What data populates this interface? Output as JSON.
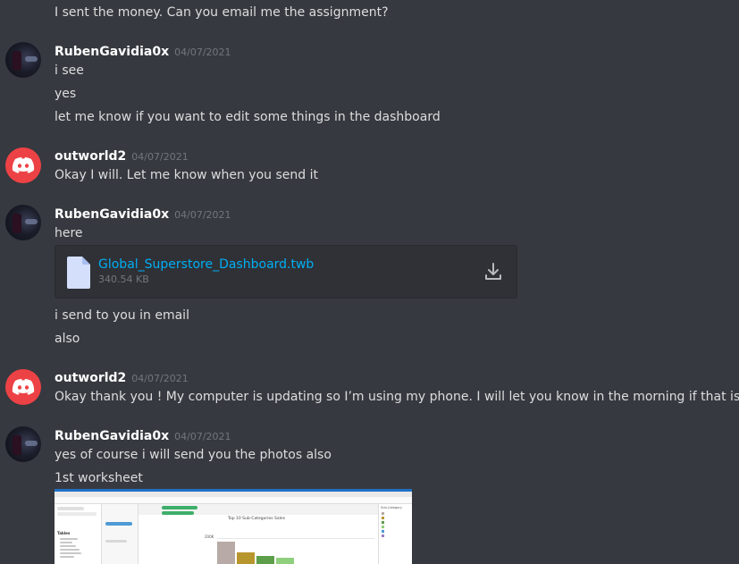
{
  "messages": [
    {
      "text": "I sent the money. Can you email me the assignment?"
    },
    {
      "username": "RubenGavidia0x",
      "timestamp": "04/07/2021",
      "avatar": "user-photo",
      "lines": [
        "i see",
        "yes",
        "let me know if you want to edit some things in the dashboard"
      ]
    },
    {
      "username": "outworld2",
      "timestamp": "04/07/2021",
      "avatar": "discord-logo",
      "lines": [
        "Okay I will. Let me know when you send it"
      ]
    },
    {
      "username": "RubenGavidia0x",
      "timestamp": "04/07/2021",
      "avatar": "user-photo",
      "lines": [
        "here"
      ],
      "attachment": {
        "filename": "Global_Superstore_Dashboard.twb",
        "size": "340.54 KB",
        "icon": "file-icon",
        "download_icon": "download-icon"
      },
      "after_lines": [
        "i send to you in email",
        "also"
      ]
    },
    {
      "username": "outworld2",
      "timestamp": "04/07/2021",
      "avatar": "discord-logo",
      "lines": [
        "Okay thank you ! My computer is updating so I’m using my phone. I will let you know in the morning if that is okay?"
      ]
    },
    {
      "username": "RubenGavidia0x",
      "timestamp": "04/07/2021",
      "avatar": "user-photo",
      "lines": [
        "yes of course i will send you the photos also",
        "1st worksheet"
      ],
      "image": {
        "chart_title": "Top 10 Sub-Categories Sales",
        "y_tick": "200K",
        "panel_header": "Tables",
        "right_header": "Sub-Category"
      }
    }
  ],
  "colors": {
    "background": "#36393f",
    "username": "#ffffff",
    "timestamp": "#72767d",
    "link": "#00aff4",
    "discord_red": "#ed4245"
  }
}
